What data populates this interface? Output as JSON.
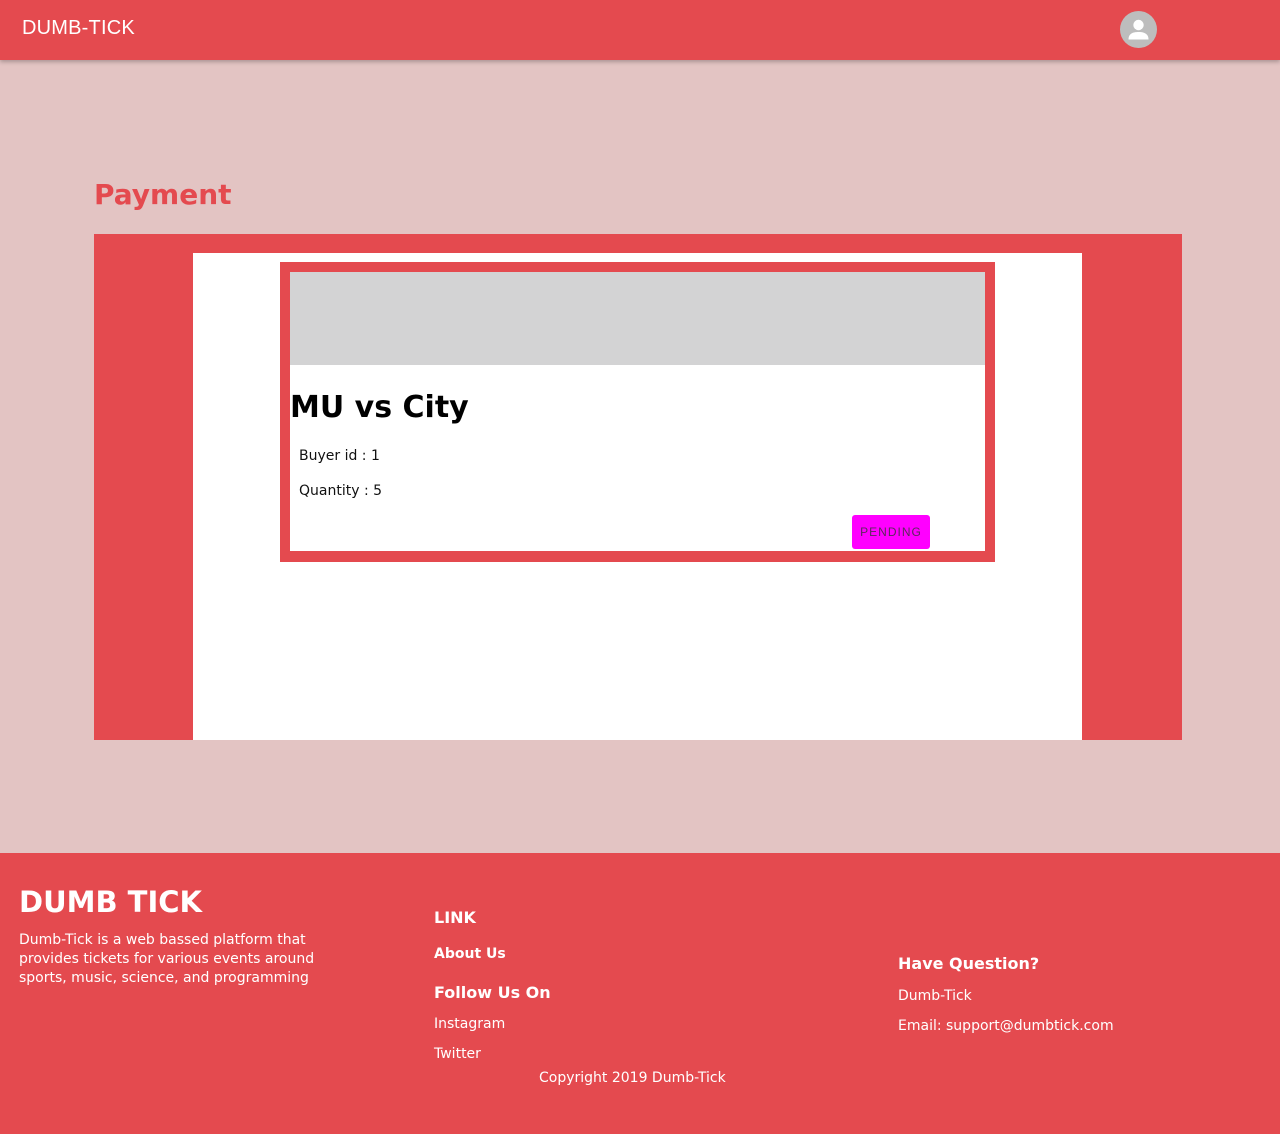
{
  "header": {
    "brand": "DUMB-TICK",
    "avatar_icon": "account-circle-icon"
  },
  "main": {
    "title": "Payment",
    "ticket": {
      "event_title": "MU vs City",
      "buyer_id": "Buyer id : 1",
      "quantity": "Quantity : 5",
      "status_label": "PENDING",
      "status_color": "#ff00ff"
    }
  },
  "footer": {
    "brand": "DUMB TICK",
    "description": "Dumb-Tick is a web bassed platform that provides tickets for various events around sports, music, science, and programming",
    "link_heading": "LINK",
    "about_us": "About Us",
    "follow_heading": "Follow Us On",
    "instagram": "Instagram",
    "twitter": "Twitter",
    "copyright": "Copyright 2019 Dumb-Tick",
    "question_heading": "Have Question?",
    "contact_name": "Dumb-Tick",
    "contact_email": "Email: support@dumbtick.com"
  },
  "colors": {
    "brand_red": "#e44a4f",
    "page_background": "#e3c4c3"
  }
}
